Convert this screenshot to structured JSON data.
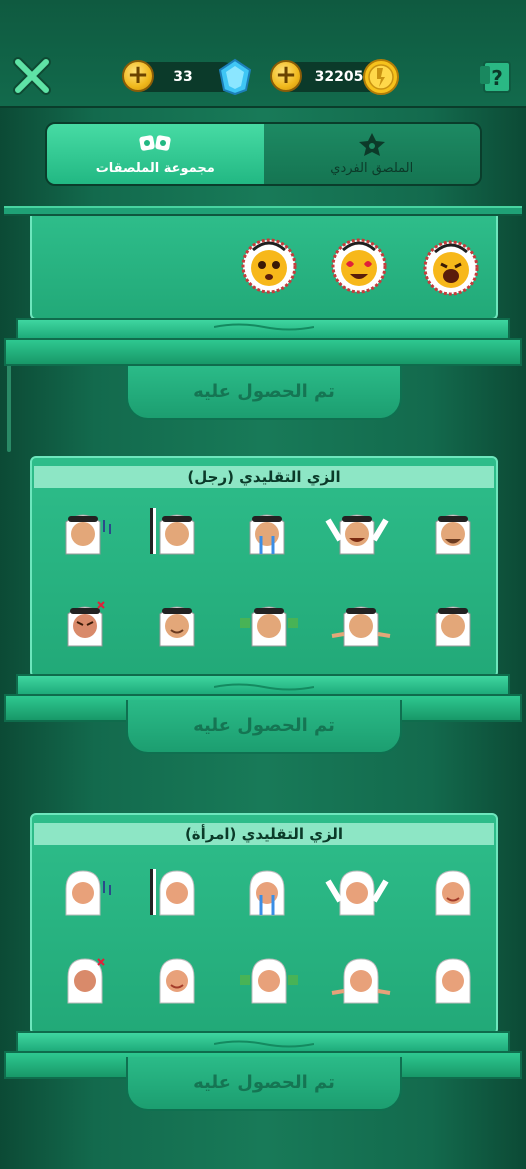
{
  "header": {
    "gems": "33",
    "coins": "32205"
  },
  "tabs": [
    {
      "label": "مجموعة الملصقات",
      "active": true
    },
    {
      "label": "الملصق الفردي",
      "active": false
    }
  ],
  "packs": [
    {
      "title": "",
      "status": "تم الحصول عليه",
      "stickers": [
        "emoji-yelling",
        "emoji-heart-eyes",
        "emoji-worried"
      ]
    },
    {
      "title": "الزي التقليدي (رجل)",
      "status": "تم الحصول عليه",
      "stickers": [
        "man-wink",
        "man-cheering",
        "man-crying",
        "man-peeking",
        "man-music",
        "man-kiss",
        "man-money",
        "man-money-hands",
        "man-smile",
        "man-angry"
      ]
    },
    {
      "title": "الزي التقليدي (امرأة)",
      "status": "تم الحصول عليه",
      "stickers": [
        "woman-wink",
        "woman-cheering",
        "woman-crying",
        "woman-peeking",
        "woman-music",
        "woman-kiss",
        "woman-money",
        "woman-money-hands",
        "woman-smile",
        "woman-angry"
      ]
    }
  ],
  "colors": {
    "accent": "#22b883",
    "gold": "#f0b81c",
    "gem": "#4fd3ff"
  }
}
